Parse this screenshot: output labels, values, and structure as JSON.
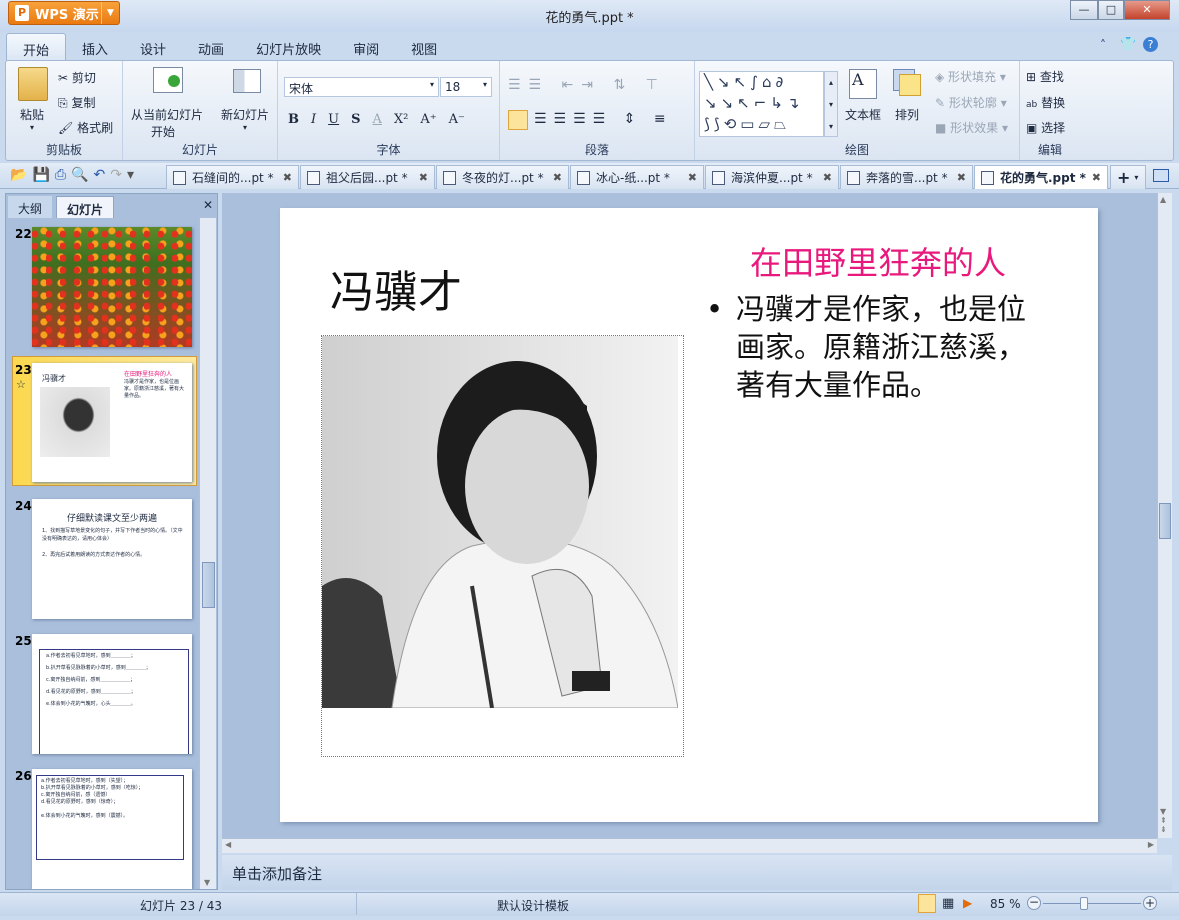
{
  "app": {
    "name": "WPS 演示",
    "window_title": "花的勇气.ppt *"
  },
  "window_controls": {
    "minimize": "—",
    "maximize": "□",
    "close": "✕"
  },
  "menu_tabs": [
    "开始",
    "插入",
    "设计",
    "动画",
    "幻灯片放映",
    "审阅",
    "视图"
  ],
  "ribbon": {
    "clipboard": {
      "paste": "粘贴",
      "cut": "剪切",
      "copy": "复制",
      "format_painter": "格式刷",
      "label": "剪贴板"
    },
    "slides": {
      "from_current": "从当前幻灯片",
      "start": "开始",
      "new_slide": "新幻灯片",
      "label": "幻灯片"
    },
    "font": {
      "font_name": "宋体",
      "font_size": "18",
      "bold": "B",
      "italic": "I",
      "underline": "U",
      "shadow": "S",
      "color": "A",
      "superscript": "X²",
      "grow": "A⁺",
      "shrink": "A⁻",
      "label": "字体"
    },
    "paragraph": {
      "label": "段落"
    },
    "drawing": {
      "textbox": "文本框",
      "arrange": "排列",
      "shape_fill": "形状填充",
      "shape_outline": "形状轮廓",
      "shape_effect": "形状效果",
      "label": "绘图"
    },
    "edit": {
      "find": "查找",
      "replace": "替换",
      "select": "选择",
      "label": "编辑"
    }
  },
  "doc_tabs": [
    "石缝间的...pt *",
    "祖父后园...pt *",
    "冬夜的灯...pt *",
    "冰心-纸...pt *",
    "海滨仲夏...pt *",
    "奔落的雪...pt *",
    "花的勇气.ppt *"
  ],
  "panel": {
    "tabs": [
      "大纲",
      "幻灯片"
    ],
    "close": "✕"
  },
  "thumbnails": [
    {
      "num": "22"
    },
    {
      "num": "23",
      "title": "冯骥才",
      "heading": "在田野里狂奔的人",
      "body": "冯骥才是作家，也是位画家。原籍浙江慈溪，著有大量作品。"
    },
    {
      "num": "24",
      "title": "仔细默读课文至少两遍",
      "lines": [
        "1、找到描写草地景变化的句子，并写下作者当时的心情。（文中没有明确表达的，请用心体会）",
        "2、再完后试着用朗读的方式表达作者的心情。"
      ]
    },
    {
      "num": "25",
      "lines": [
        "a.作者去初看见草地时，感到＿＿＿＿；",
        "b.扒开草看见脉脉着的小草时，感到＿＿＿＿；",
        "c.离开独自纳闷前，感到＿＿＿＿＿＿；",
        "d.看见花的原野时，感到＿＿＿＿＿＿；",
        "e.体会到小花的气魄时，心头＿＿＿＿。"
      ]
    },
    {
      "num": "26",
      "lines": [
        "a.作者去初看见草地时，感到（失望）；",
        "b.扒开草看见脉脉着的小草时，感到（吃惊）；",
        "c.离开独自纳闷前，感（遗憾）",
        "d.看见花的原野时，感到（惊奇）；",
        "e.体会到小花的气魄时，感到（震撼）。"
      ]
    }
  ],
  "slide": {
    "title": "冯骥才",
    "heading": "在田野里狂奔的人",
    "bullet": "冯骥才是作家，也是位画家。原籍浙江慈溪，著有大量作品。",
    "heading_color": "#e8187c"
  },
  "notes_placeholder": "单击添加备注",
  "status": {
    "slide_counter": "幻灯片 23 / 43",
    "template": "默认设计模板",
    "zoom": "85 %",
    "zoom_level": 85
  }
}
